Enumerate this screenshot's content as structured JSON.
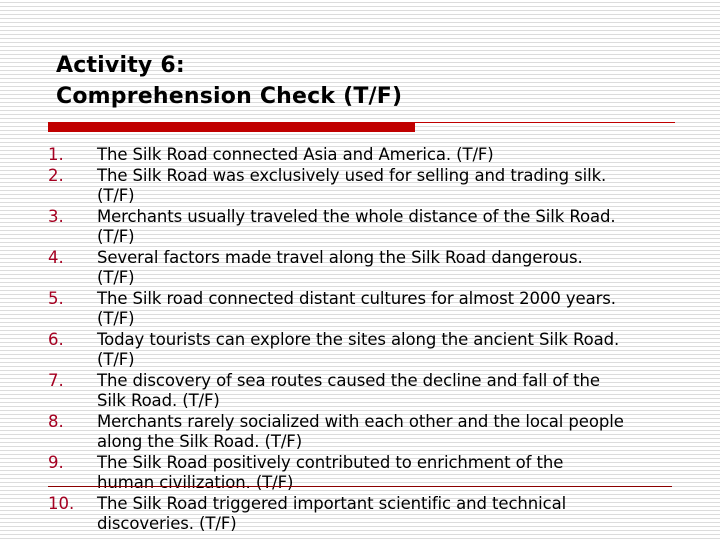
{
  "title": {
    "line1": "Activity 6:",
    "line2": "Comprehension Check (T/F)"
  },
  "colors": {
    "accent": "#c00000",
    "number": "#a50021",
    "bottom_rule": "#8b0000"
  },
  "items": [
    {
      "num": "1.",
      "text": "The Silk Road connected Asia and America. (T/F)"
    },
    {
      "num": "2.",
      "text": "The Silk Road was exclusively used for selling and trading silk.\n(T/F)"
    },
    {
      "num": "3.",
      "text": "Merchants usually traveled the whole distance of the Silk Road.\n(T/F)"
    },
    {
      "num": "4.",
      "text": "Several factors made travel along the Silk Road dangerous.\n(T/F)"
    },
    {
      "num": "5.",
      "text": "The Silk road connected distant cultures for almost 2000 years.\n(T/F)"
    },
    {
      "num": "6.",
      "text": "Today tourists can explore the sites along the ancient Silk Road.\n(T/F)"
    },
    {
      "num": "7.",
      "text": "The discovery of sea routes caused the decline and fall of the\nSilk Road. (T/F)"
    },
    {
      "num": "8.",
      "text": "Merchants rarely socialized with each other and the local people\nalong the Silk Road. (T/F)"
    },
    {
      "num": "9.",
      "text": "The Silk Road positively contributed to enrichment of the\nhuman civilization. (T/F)"
    },
    {
      "num": "10.",
      "text": "The Silk Road triggered important scientific and technical\ndiscoveries. (T/F)"
    }
  ]
}
